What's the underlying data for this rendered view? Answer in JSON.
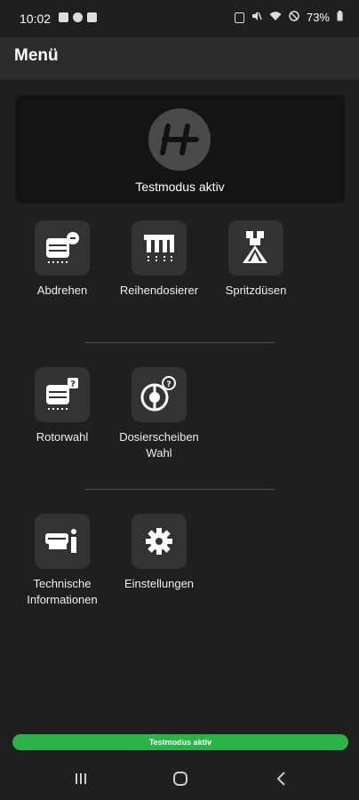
{
  "status_bar": {
    "time": "10:02",
    "battery": "73%"
  },
  "app_bar": {
    "title": "Menü"
  },
  "hero": {
    "status": "Testmodus aktiv"
  },
  "menu": {
    "row1": [
      {
        "label": "Abdrehen",
        "icon": "abdrehen-icon"
      },
      {
        "label": "Reihendosierer",
        "icon": "reihendosierer-icon"
      },
      {
        "label": "Spritzdüsen",
        "icon": "spritzduesen-icon"
      }
    ],
    "row2": [
      {
        "label": "Rotorwahl",
        "icon": "rotorwahl-icon"
      },
      {
        "label": "Dosierscheiben Wahl",
        "icon": "dosierscheiben-icon"
      }
    ],
    "row3": [
      {
        "label": "Technische Informationen",
        "icon": "info-icon"
      },
      {
        "label": "Einstellungen",
        "icon": "gear-icon"
      }
    ]
  },
  "footer": {
    "banner": "Testmodus aktiv"
  },
  "colors": {
    "accent": "#2bb34a",
    "background": "#1f1f1f",
    "tile": "#333333"
  }
}
